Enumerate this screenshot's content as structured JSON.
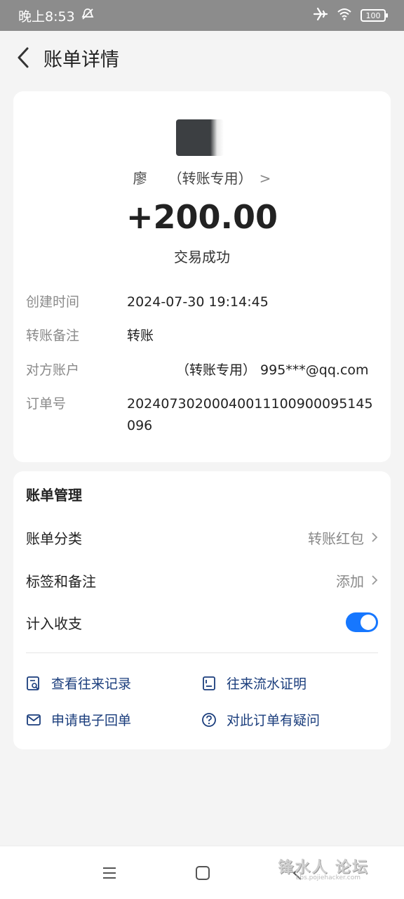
{
  "status_bar": {
    "time": "晚上8:53",
    "battery": "100"
  },
  "header": {
    "title": "账单详情"
  },
  "transaction": {
    "payee_name": "廖　　（转账专用）",
    "amount": "+200.00",
    "status": "交易成功",
    "details": [
      {
        "label": "创建时间",
        "value": "2024-07-30 19:14:45"
      },
      {
        "label": "转账备注",
        "value": "转账"
      },
      {
        "label": "对方账户",
        "value": "（转账专用） 995***@qq.com"
      },
      {
        "label": "订单号",
        "value": "20240730200040011100900095145096"
      }
    ]
  },
  "manage": {
    "title": "账单管理",
    "category_label": "账单分类",
    "category_value": "转账红包",
    "tags_label": "标签和备注",
    "tags_value": "添加",
    "include_label": "计入收支",
    "include_enabled": true,
    "actions": [
      {
        "label": "查看往来记录",
        "icon": "records-search-icon"
      },
      {
        "label": "往来流水证明",
        "icon": "statement-icon"
      },
      {
        "label": "申请电子回单",
        "icon": "mail-icon"
      },
      {
        "label": "对此订单有疑问",
        "icon": "question-icon"
      }
    ]
  },
  "watermark": {
    "main": "锋水人 论坛",
    "sub": "bbs.pojiehacker.com"
  },
  "colors": {
    "accent": "#1677ff",
    "action_text": "#1a3d7c",
    "status_bar": "#8c8c8c"
  }
}
